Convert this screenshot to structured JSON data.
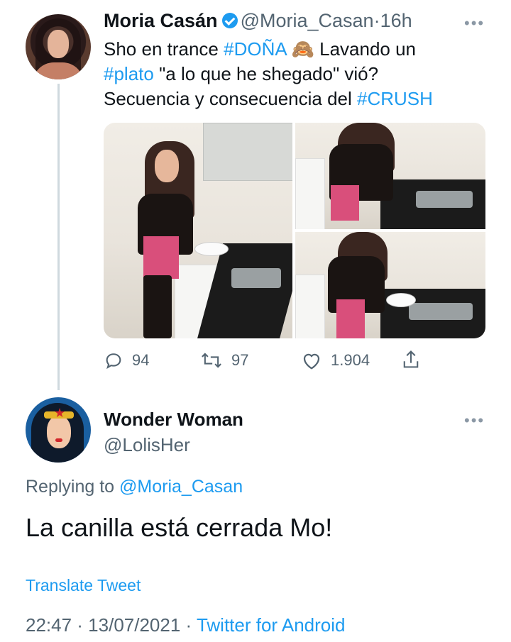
{
  "tweet1": {
    "author_name": "Moria Casán",
    "handle": "@Moria_Casan",
    "separator": "·",
    "time": "16h",
    "text_line1_a": "Sho en trance ",
    "hashtag_dona": "#DOÑA",
    "emoji": "🙈",
    "text_line1_b": " Lavando un",
    "hashtag_plato": "#plato",
    "text_line2": " \"a lo que he shegado\" vió?",
    "text_line3": "Secuencia y consecuencia del ",
    "hashtag_crush": "#CRUSH",
    "more_label": "•••",
    "actions": {
      "replies": "94",
      "retweets": "97",
      "likes": "1.904"
    }
  },
  "tweet2": {
    "author_name": "Wonder Woman",
    "handle": "@LolisHer",
    "more_label": "•••",
    "replying_prefix": "Replying to ",
    "replying_handle": "@Moria_Casan",
    "text": "La canilla está cerrada Mo!",
    "translate": "Translate Tweet",
    "timestamp": "22:47 · 13/07/2021 · ",
    "source": "Twitter for Android"
  },
  "colors": {
    "link": "#1d9bf0",
    "muted": "#536471",
    "text": "#0f1419",
    "verified": "#1d9bf0"
  },
  "icons": [
    "verified-badge-icon",
    "reply-icon",
    "retweet-icon",
    "like-icon",
    "share-icon",
    "more-icon"
  ]
}
